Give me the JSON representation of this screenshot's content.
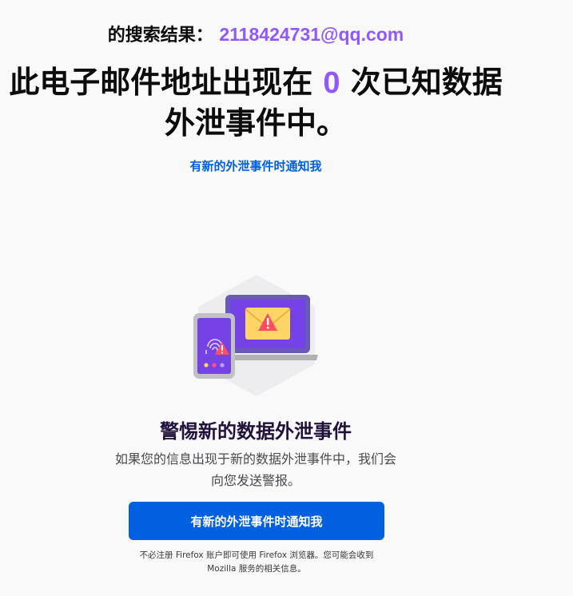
{
  "search": {
    "label": "的搜索结果：",
    "email": "2118424731@qq.com"
  },
  "headline": {
    "before": "此电子邮件地址出现在 ",
    "count": "0",
    "after": " 次已知数据外泄事件中。"
  },
  "top_link": "有新的外泄事件时通知我",
  "card": {
    "title": "警惕新的数据外泄事件",
    "description": "如果您的信息出现于新的数据外泄事件中，我们会向您发送警报。",
    "button_label": "有新的外泄事件时通知我",
    "note": "不必注册 Firefox 账户即可使用 Firefox 浏览器。您可能会收到 Mozilla 服务的相关信息。"
  },
  "colors": {
    "accent_purple": "#9059ff",
    "link_blue": "#0060df",
    "button_blue": "#0060df",
    "background": "#f9f9fa"
  },
  "icons": {
    "illustration": "device-breach-alert-illustration"
  }
}
